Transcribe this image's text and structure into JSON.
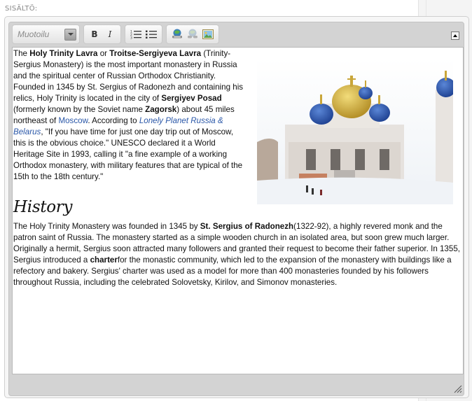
{
  "section_label": "SISÄLTÖ:",
  "toolbar": {
    "format_placeholder": "Muotoilu",
    "bold_label": "B",
    "italic_label": "I",
    "icons": [
      "numbered-list-icon",
      "bullet-list-icon",
      "link-icon",
      "unlink-icon",
      "image-icon"
    ]
  },
  "content": {
    "intro": {
      "t1": "The ",
      "b1": "Holy Trinity Lavra",
      "t2": " or ",
      "b2": "Troitse-Sergiyeva Lavra",
      "t3": " (Trinity-Sergius Monastery) is the most important monastery in Russia and the spiritual center of Russian Orthodox Christianity. Founded in 1345 by St. Sergius of Radonezh and containing his relics, Holy Trinity is located in the city of ",
      "b3": "Sergiyev Posad",
      "t4": " (formerly known by the Soviet name ",
      "b4": "Zagorsk",
      "t5": ") about 45 miles northeast of ",
      "link1": "Moscow",
      "t6": ". According to ",
      "link2": "Lonely Planet Russia & Belarus",
      "t7": ", \"If you have time for just one day trip out of Moscow, this is the obvious choice.\" UNESCO declared it a World Heritage Site in 1993, calling it \"a fine example of a working Orthodox monastery, with military features that are typical of the 15th to the 18th century.\""
    },
    "heading": "History",
    "history": {
      "t1": "The Holy Trinity Monastery was founded in 1345 by ",
      "b1": "St. Sergius of Radonezh",
      "t2": "(1322-92), a highly revered monk and the patron saint of Russia. The monastery started as a simple wooden church in an isolated area, but soon grew much larger.",
      "t3": "Originally a hermit, Sergius soon attracted many followers and granted their request to become their father superior. In 1355, Sergius introduced a ",
      "b2": "charter",
      "t4": "for the monastic community, which led to the expansion of the monastery with buildings like a refectory and bakery. Sergius' charter was used as a model for more than 400 monasteries founded by his followers throughout Russia, including the celebrated Solovetsky, Kirilov, and Simonov monasteries."
    }
  },
  "colors": {
    "link": "#2a57a8",
    "dome_blue": "#2b58b8",
    "dome_gold": "#d8b43a"
  }
}
